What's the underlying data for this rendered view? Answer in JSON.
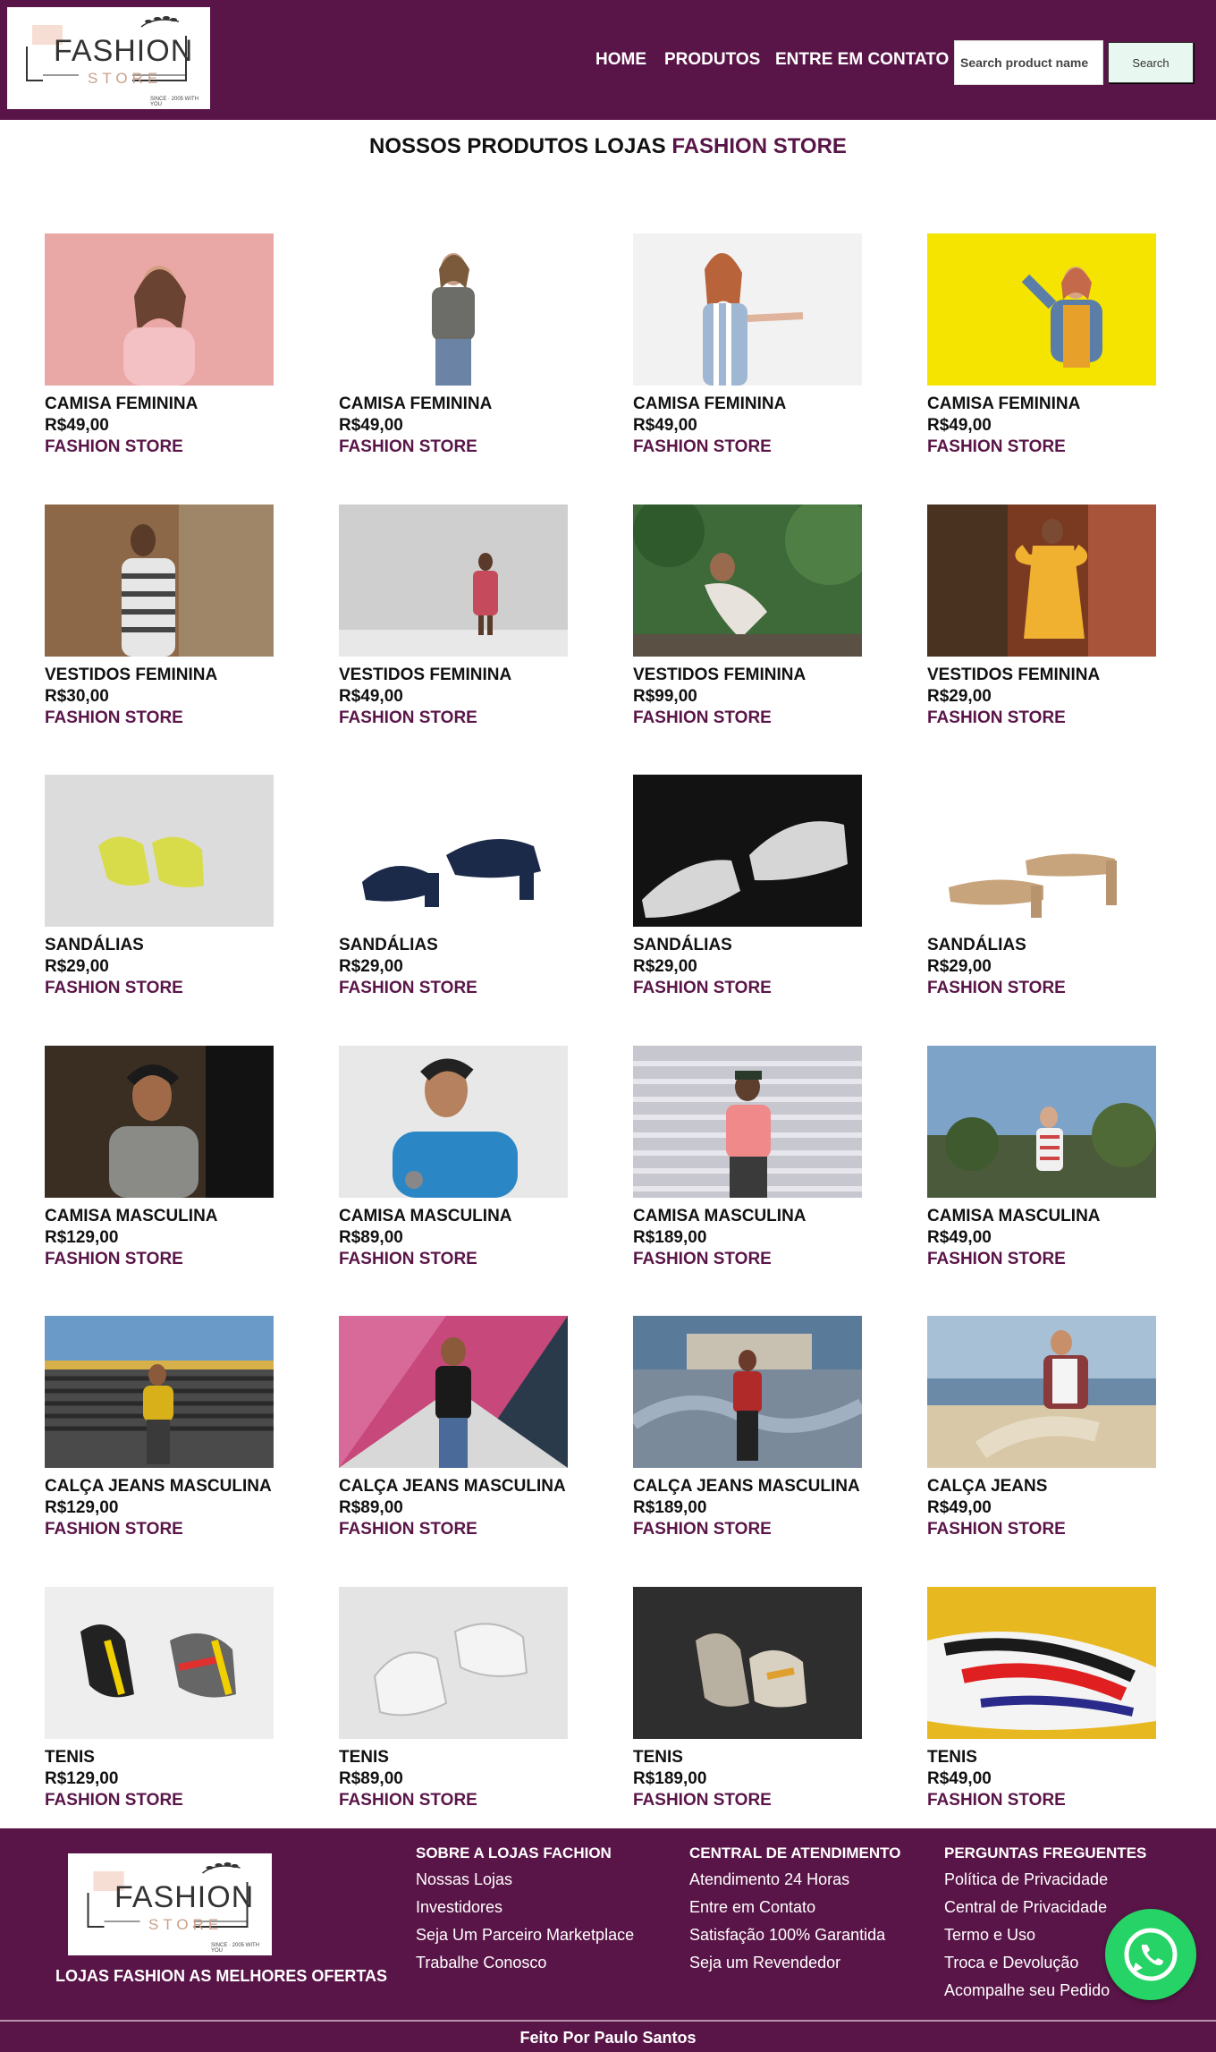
{
  "brand": {
    "logo_fashion": "FASHION",
    "logo_store": "STORE",
    "logo_since": "SINCE · 2005 WITH YOU",
    "accent": "#5a1548"
  },
  "nav": {
    "items": [
      "HOME",
      "PRODUTOS",
      "ENTRE EM CONTATO"
    ]
  },
  "search": {
    "placeholder": "Search product name",
    "button": "Search"
  },
  "page_title": {
    "prefix": "NOSSOS PRODUTOS LOJAS ",
    "accent": "FASHION STORE"
  },
  "products": [
    {
      "name": "CAMISA FEMININA",
      "price": "R$49,00",
      "store": "FASHION STORE"
    },
    {
      "name": "CAMISA FEMININA",
      "price": "R$49,00",
      "store": "FASHION STORE"
    },
    {
      "name": "CAMISA FEMININA",
      "price": "R$49,00",
      "store": "FASHION STORE"
    },
    {
      "name": "CAMISA FEMININA",
      "price": "R$49,00",
      "store": "FASHION STORE"
    },
    {
      "name": "VESTIDOS FEMININA",
      "price": "R$30,00",
      "store": "FASHION STORE"
    },
    {
      "name": "VESTIDOS FEMININA",
      "price": "R$49,00",
      "store": "FASHION STORE"
    },
    {
      "name": "VESTIDOS FEMININA",
      "price": "R$99,00",
      "store": "FASHION STORE"
    },
    {
      "name": "VESTIDOS FEMININA",
      "price": "R$29,00",
      "store": "FASHION STORE"
    },
    {
      "name": "SANDÁLIAS",
      "price": "R$29,00",
      "store": "FASHION STORE"
    },
    {
      "name": "SANDÁLIAS",
      "price": "R$29,00",
      "store": "FASHION STORE"
    },
    {
      "name": "SANDÁLIAS",
      "price": "R$29,00",
      "store": "FASHION STORE"
    },
    {
      "name": "SANDÁLIAS",
      "price": "R$29,00",
      "store": "FASHION STORE"
    },
    {
      "name": "CAMISA MASCULINA",
      "price": "R$129,00",
      "store": "FASHION STORE"
    },
    {
      "name": "CAMISA MASCULINA",
      "price": "R$89,00",
      "store": "FASHION STORE"
    },
    {
      "name": "CAMISA MASCULINA",
      "price": "R$189,00",
      "store": "FASHION STORE"
    },
    {
      "name": "CAMISA MASCULINA",
      "price": "R$49,00",
      "store": "FASHION STORE"
    },
    {
      "name": "CALÇA JEANS MASCULINA",
      "price": "R$129,00",
      "store": "FASHION STORE"
    },
    {
      "name": "CALÇA JEANS MASCULINA",
      "price": "R$89,00",
      "store": "FASHION STORE"
    },
    {
      "name": "CALÇA JEANS MASCULINA",
      "price": "R$189,00",
      "store": "FASHION STORE"
    },
    {
      "name": "CALÇA JEANS",
      "price": "R$49,00",
      "store": "FASHION STORE"
    },
    {
      "name": "TENIS",
      "price": "R$129,00",
      "store": "FASHION STORE"
    },
    {
      "name": "TENIS",
      "price": "R$89,00",
      "store": "FASHION STORE"
    },
    {
      "name": "TENIS",
      "price": "R$189,00",
      "store": "FASHION STORE"
    },
    {
      "name": "TENIS",
      "price": "R$49,00",
      "store": "FASHION STORE"
    }
  ],
  "footer": {
    "tagline": "LOJAS FASHION AS MELHORES OFERTAS",
    "columns": [
      {
        "title": "SOBRE A LOJAS FACHION",
        "links": [
          "Nossas Lojas",
          "Investidores",
          "Seja Um Parceiro Marketplace",
          "Trabalhe Conosco"
        ]
      },
      {
        "title": "CENTRAL DE ATENDIMENTO",
        "links": [
          "Atendimento 24 Horas",
          "Entre em Contato",
          "Satisfação 100% Garantida",
          "Seja um Revendedor"
        ]
      },
      {
        "title": "PERGUNTAS FREGUENTES",
        "links": [
          "Política de Privacidade",
          "Central de Privacidade",
          "Termo e Uso",
          "Troca e Devolução",
          "Acompalhe seu Pedido"
        ]
      }
    ],
    "credit": "Feito Por Paulo Santos",
    "whatsapp_icon": "whatsapp-icon"
  }
}
